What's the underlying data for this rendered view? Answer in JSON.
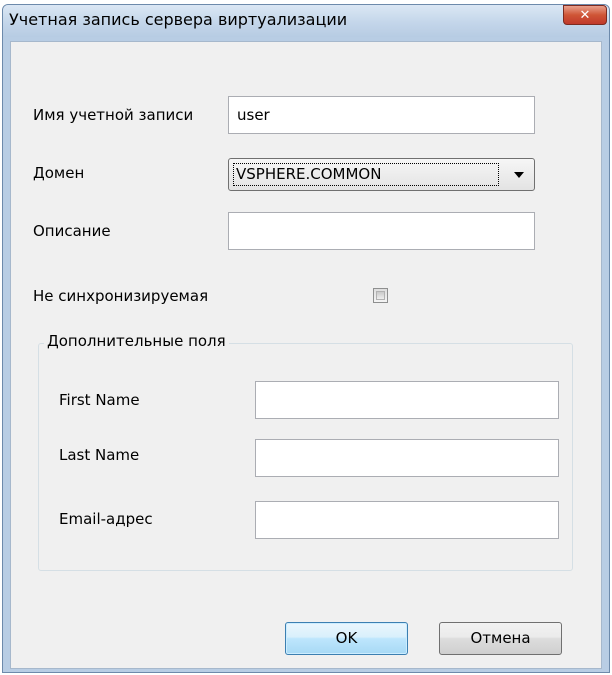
{
  "window": {
    "title": "Учетная запись сервера виртуализации"
  },
  "form": {
    "account_name_label": "Имя учетной записи",
    "account_name_value": "user",
    "domain_label": "Домен",
    "domain_selected": "VSPHERE.COMMON",
    "description_label": "Описание",
    "description_value": "",
    "not_synced_label": "Не синхронизируемая",
    "not_synced_checked": false
  },
  "extra_fields": {
    "title": "Дополнительные поля",
    "first_name_label": "First Name",
    "first_name_value": "",
    "last_name_label": "Last Name",
    "last_name_value": "",
    "email_label": "Email-адрес",
    "email_value": ""
  },
  "buttons": {
    "ok_label": "OK",
    "cancel_label": "Отмена"
  },
  "colors": {
    "close_button": "#c74b32",
    "titlebar": "#c4d6ea",
    "client_bg": "#f0f0f0",
    "default_button": "#bee6fd"
  },
  "icons": {
    "close": "close-icon",
    "dropdown": "chevron-down-icon"
  }
}
